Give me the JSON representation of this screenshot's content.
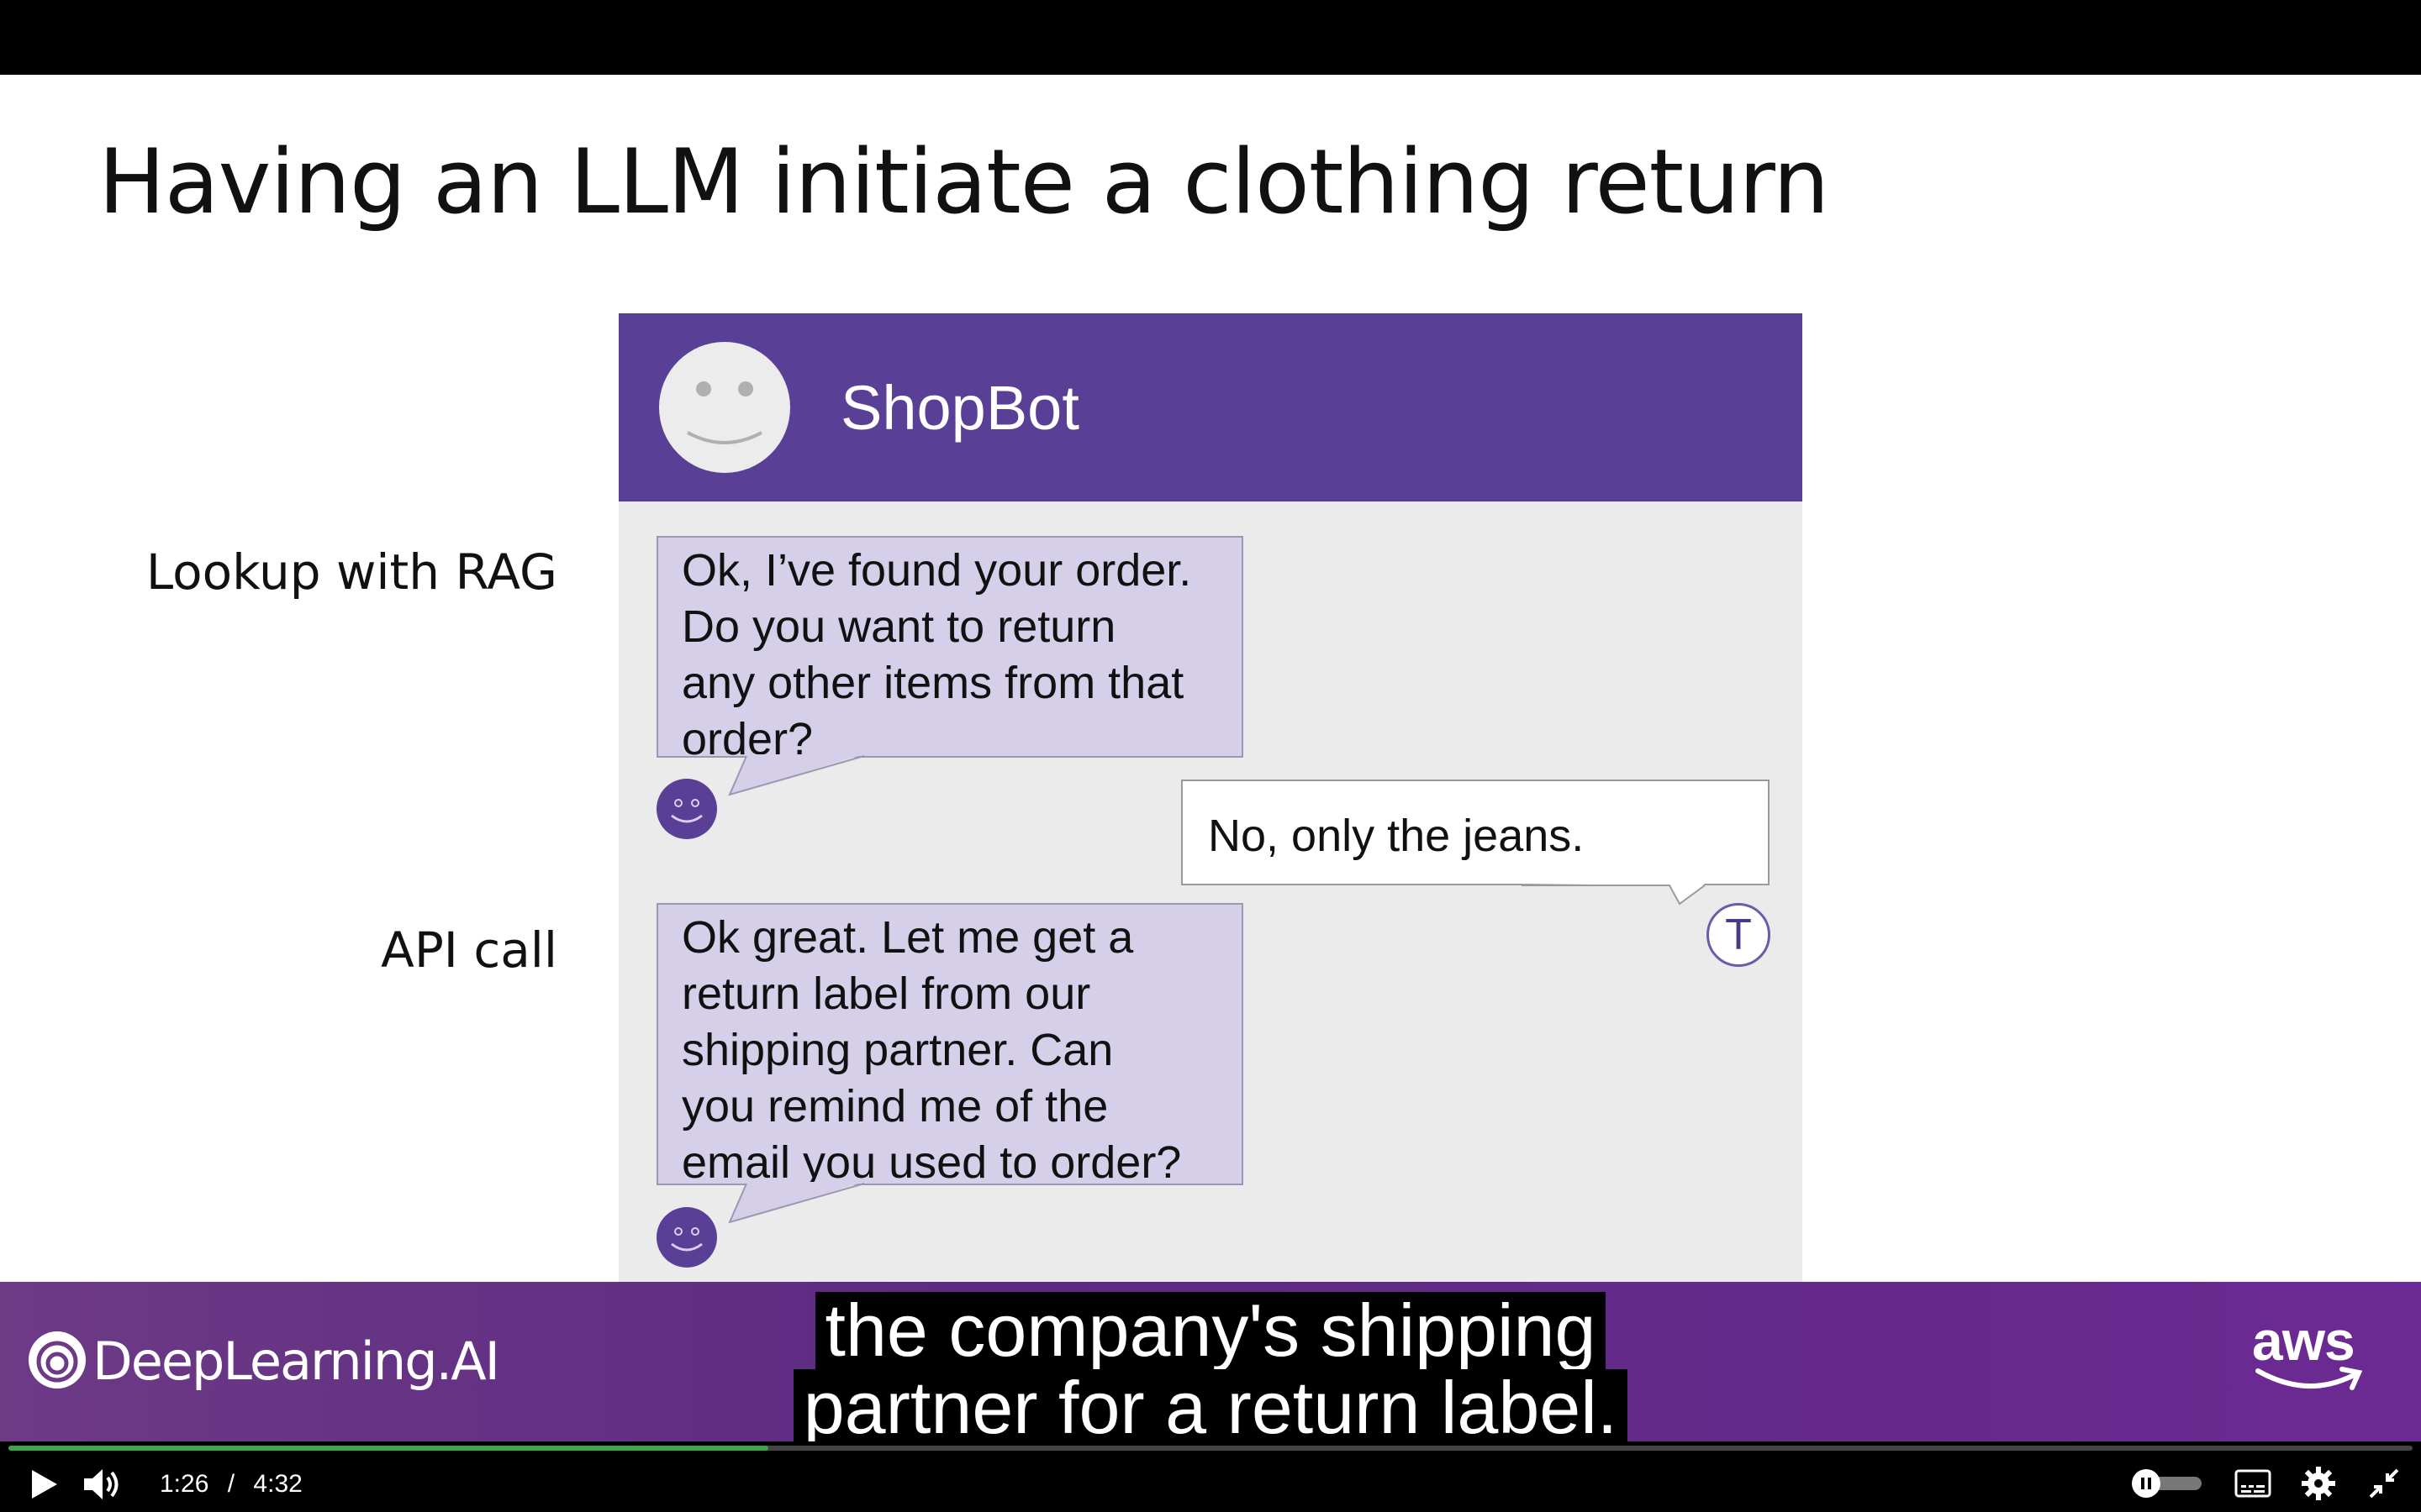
{
  "slide": {
    "title": "Having an LLM initiate a clothing return",
    "labels": {
      "rag": "Lookup with RAG",
      "api": "API call"
    }
  },
  "chat": {
    "bot_name": "ShopBot",
    "messages": [
      {
        "sender": "bot",
        "lines": [
          "Ok, I’ve found your order.",
          "Do you want to return",
          "any other items from that",
          "order?"
        ]
      },
      {
        "sender": "user",
        "text": "No, only the jeans."
      },
      {
        "sender": "bot",
        "lines": [
          "Ok great. Let me get a",
          "return label from our",
          "shipping partner.  Can",
          "you remind me of the",
          "email you used to order?"
        ]
      }
    ],
    "user_initial": "T"
  },
  "banner": {
    "brand": "DeepLearning.AI",
    "partner": "aws"
  },
  "caption": {
    "lines": [
      "the company's shipping",
      "partner for a return label."
    ]
  },
  "player": {
    "current_time": "1:26",
    "separator": "/",
    "duration": "4:32",
    "progress": 0.316,
    "colors": {
      "progress": "#3da546"
    }
  },
  "colors": {
    "header": "#5a3f97",
    "bot_bubble": "#d6cfe9",
    "banner": "#6b2a93"
  },
  "icons": {
    "play": "play-icon",
    "volume": "volume-icon",
    "autoplay": "toggle-pause-icon",
    "captions": "captions-icon",
    "settings": "gear-icon",
    "exit_fullscreen": "exit-fullscreen-icon"
  }
}
